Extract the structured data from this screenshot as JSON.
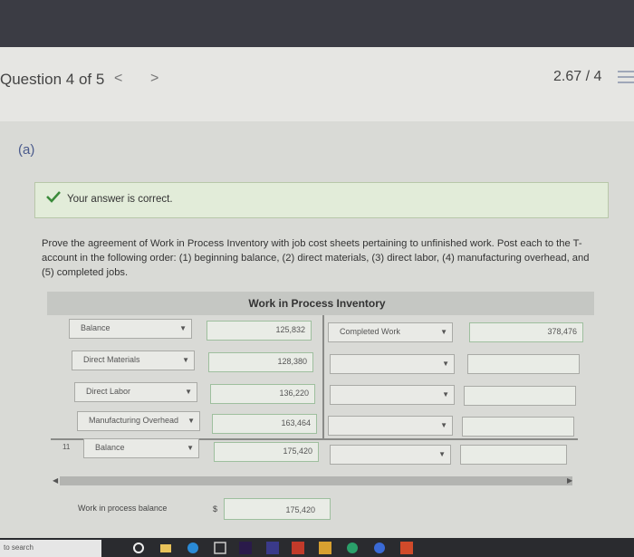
{
  "header": {
    "question_label": "Question 4 of 5",
    "prev_label": "<",
    "next_label": ">",
    "score": "2.67 / 4"
  },
  "part": {
    "label": "(a)"
  },
  "feedback": {
    "text": "Your answer is correct."
  },
  "instructions": "Prove the agreement of Work in Process Inventory with job cost sheets pertaining to unfinished work. Post each to the T-account in the following order: (1) beginning balance, (2) direct materials, (3) direct labor, (4) manufacturing overhead, and (5) completed jobs.",
  "t_account": {
    "title": "Work in Process Inventory",
    "debit_rows": [
      {
        "account": "Balance",
        "amount": "125,832"
      },
      {
        "account": "Direct Materials",
        "amount": "128,380"
      },
      {
        "account": "Direct Labor",
        "amount": "136,220"
      },
      {
        "account": "Manufacturing Overhead",
        "amount": "163,464"
      }
    ],
    "credit_rows": [
      {
        "account": "Completed Work",
        "amount": "378,476"
      },
      {
        "account": "",
        "amount": ""
      },
      {
        "account": "",
        "amount": ""
      },
      {
        "account": "",
        "amount": ""
      }
    ],
    "balance_row": {
      "row_number": "11",
      "account": "Balance",
      "amount": "175,420"
    }
  },
  "summary": {
    "label": "Work in process balance",
    "currency": "$",
    "amount": "175,420"
  },
  "taskbar": {
    "search_text": "to search"
  },
  "colors": {
    "top_bar": "#3b3c44",
    "correct_bg": "#e2ecd9",
    "check": "#3a8a3a",
    "part_label": "#4a5a8c"
  }
}
